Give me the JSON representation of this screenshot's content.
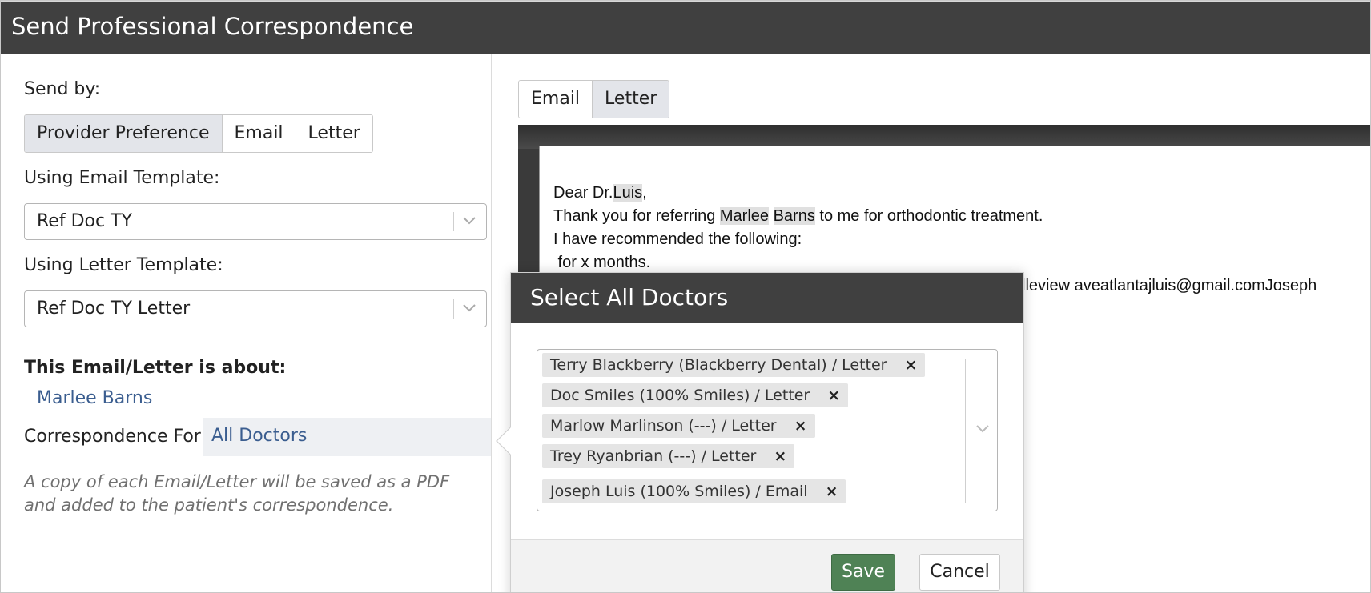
{
  "window": {
    "title": "Send Professional Correspondence"
  },
  "left": {
    "send_by_label": "Send by:",
    "send_by_options": [
      "Provider Preference",
      "Email",
      "Letter"
    ],
    "send_by_selected": "Provider Preference",
    "email_template_label": "Using Email Template:",
    "email_template_value": "Ref Doc TY",
    "letter_template_label": "Using Letter Template:",
    "letter_template_value": "Ref Doc TY Letter",
    "about_label": "This Email/Letter is about:",
    "patient_name": "Marlee Barns",
    "correspondence_for_label": "Correspondence For:",
    "correspondence_for_value": "All Doctors",
    "note": "A copy of each Email/Letter will be saved as a PDF and added to the patient's correspondence."
  },
  "preview": {
    "tabs": [
      "Email",
      "Letter"
    ],
    "selected_tab": "Letter",
    "lines": {
      "greeting_prefix": "Dear Dr.",
      "greeting_name": "Luis",
      "greeting_suffix": ",",
      "thanks_prefix": "Thank you for referring ",
      "patient_first": "Marlee",
      "patient_last": "Barns",
      "thanks_suffix": " to me for orthodontic treatment.",
      "recommend": "I have recommended the following:",
      "months": " for x months.",
      "signature_fragment": "lleview aveatlantajluis@gmail.comJoseph"
    }
  },
  "modal": {
    "title": "Select All Doctors",
    "selected_doctors": [
      "Terry Blackberry (Blackberry Dental) / Letter",
      "Doc Smiles (100% Smiles) / Letter",
      "Marlow Marlinson (---) / Letter",
      "Trey Ryanbrian (---) / Letter",
      "Joseph Luis (100% Smiles) / Email"
    ],
    "remove_glyph": "×",
    "save_label": "Save",
    "cancel_label": "Cancel"
  },
  "colors": {
    "header": "#404040",
    "accent_link": "#3a5d8f",
    "save_button": "#4f8255"
  }
}
